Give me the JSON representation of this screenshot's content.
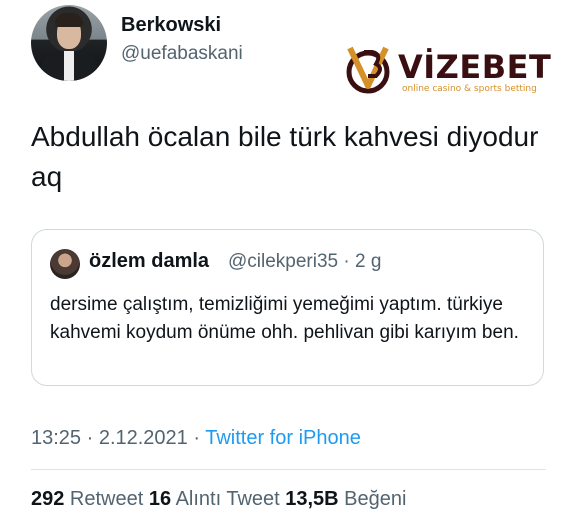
{
  "author": {
    "name": "Berkowski",
    "handle": "@uefabaskani"
  },
  "tweet": {
    "text": "Abdullah öcalan bile türk kahvesi diyodur aq"
  },
  "quote": {
    "name": "özlem damla",
    "handle": "@cilekperi35 · 2 g",
    "text": "dersime çalıştım, temizliğimi yemeğimi yaptım. türkiye kahvemi koydum önüme ohh. pehlivan gibi karıyım ben."
  },
  "meta": {
    "time": "13:25 · 2.12.2021 · ",
    "source": "Twitter for iPhone"
  },
  "stats": {
    "retweets": "292",
    "retweets_label": " Retweet ",
    "quotes": "16",
    "quotes_label": " Alıntı Tweet ",
    "likes": "13,5B",
    "likes_label": " Beğeni"
  },
  "watermark": {
    "brand": "VİZEBET",
    "tagline": "online casino & sports betting",
    "colors": {
      "dark": "#3a0f12",
      "gold": "#d6902a"
    }
  }
}
